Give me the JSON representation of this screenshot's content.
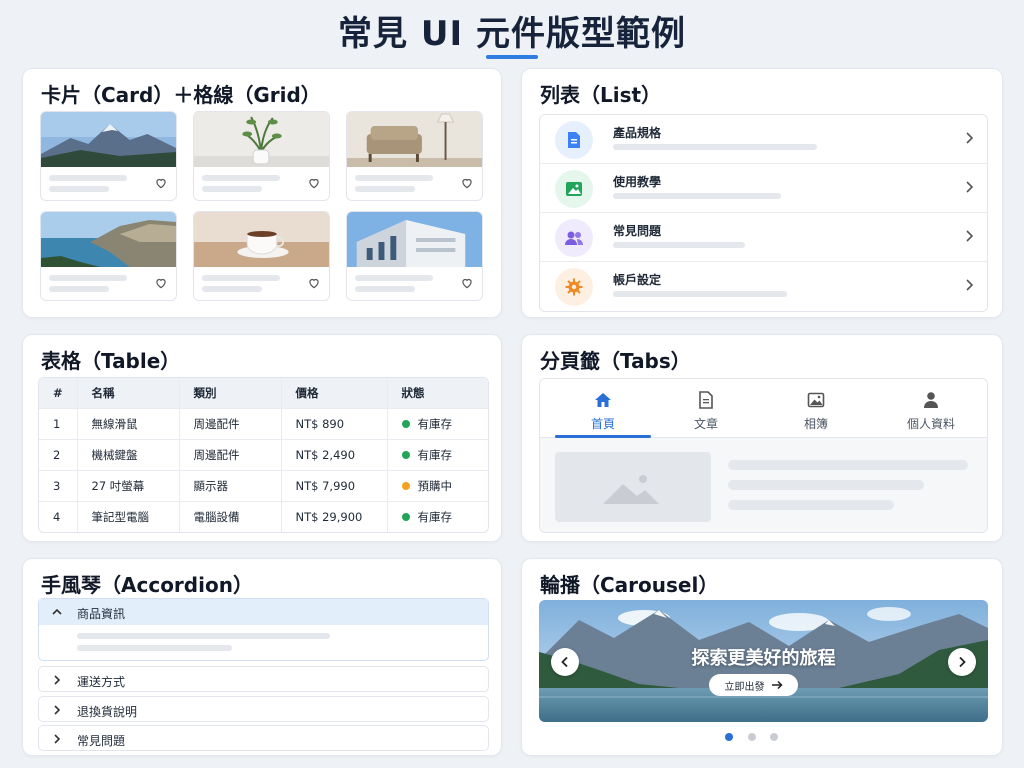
{
  "page": {
    "title": "常見 UI 元件版型範例"
  },
  "cards": {
    "title": "卡片（Card）＋格線（Grid）",
    "items": [
      {
        "image": "mountain-image"
      },
      {
        "image": "plant-vase-image"
      },
      {
        "image": "armchair-lamp-image"
      },
      {
        "image": "coastline-image"
      },
      {
        "image": "coffee-cup-image"
      },
      {
        "image": "building-image"
      }
    ]
  },
  "list": {
    "title": "列表（List）",
    "items": [
      {
        "label": "產品規格",
        "icon": "document-icon",
        "color": "#3b82f6",
        "bg": "#e6f0fd"
      },
      {
        "label": "使用教學",
        "icon": "image-icon",
        "color": "#22a559",
        "bg": "#e5f6ec"
      },
      {
        "label": "常見問題",
        "icon": "users-icon",
        "color": "#7c5ce0",
        "bg": "#efeafc"
      },
      {
        "label": "帳戶設定",
        "icon": "gear-icon",
        "color": "#f08a24",
        "bg": "#fdf0e3"
      }
    ]
  },
  "table": {
    "title": "表格（Table）",
    "headers": [
      "#",
      "名稱",
      "類別",
      "價格",
      "狀態"
    ],
    "rows": [
      {
        "no": "1",
        "name": "無線滑鼠",
        "category": "周邊配件",
        "price": "NT$ 890",
        "status": "有庫存",
        "status_color": "#22a559"
      },
      {
        "no": "2",
        "name": "機械鍵盤",
        "category": "周邊配件",
        "price": "NT$ 2,490",
        "status": "有庫存",
        "status_color": "#22a559"
      },
      {
        "no": "3",
        "name": "27 吋螢幕",
        "category": "顯示器",
        "price": "NT$ 7,990",
        "status": "預購中",
        "status_color": "#f5a020"
      },
      {
        "no": "4",
        "name": "筆記型電腦",
        "category": "電腦設備",
        "price": "NT$ 29,900",
        "status": "有庫存",
        "status_color": "#22a559"
      }
    ]
  },
  "tabs": {
    "title": "分頁籤（Tabs）",
    "items": [
      {
        "label": "首頁",
        "icon": "home-icon",
        "active": true
      },
      {
        "label": "文章",
        "icon": "document-icon",
        "active": false
      },
      {
        "label": "相簿",
        "icon": "image-icon",
        "active": false
      },
      {
        "label": "個人資料",
        "icon": "user-icon",
        "active": false
      }
    ]
  },
  "accordion": {
    "title": "手風琴（Accordion）",
    "items": [
      {
        "label": "商品資訊",
        "open": true
      },
      {
        "label": "運送方式",
        "open": false
      },
      {
        "label": "退換貨說明",
        "open": false
      },
      {
        "label": "常見問題",
        "open": false
      }
    ]
  },
  "carousel": {
    "title": "輪播（Carousel）",
    "caption": "探索更美好的旅程",
    "cta": "立即出發",
    "slide_count": 3,
    "active_slide": 1
  },
  "colors": {
    "accent": "#2a6fd6",
    "title": "#16233a"
  }
}
